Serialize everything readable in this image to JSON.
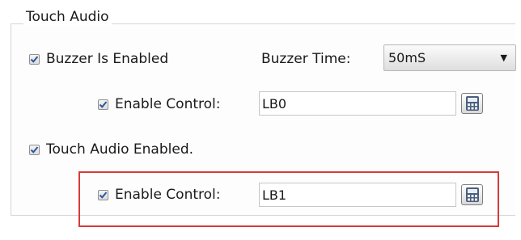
{
  "group": {
    "title": "Touch Audio"
  },
  "buzzer": {
    "enabled_label": "Buzzer Is Enabled",
    "time_label": "Buzzer Time:",
    "time_value": "50mS",
    "enable_control_label": "Enable Control:",
    "enable_control_value": "LB0"
  },
  "touch_audio": {
    "enabled_label": "Touch Audio Enabled.",
    "enable_control_label": "Enable Control:",
    "enable_control_value": "LB1"
  },
  "colors": {
    "highlight": "#d83a3a",
    "check": "#2b55a0"
  },
  "icons": {
    "checkbox_check": "check-icon",
    "address_picker": "calculator-icon",
    "dropdown": "chevron-down-icon"
  }
}
